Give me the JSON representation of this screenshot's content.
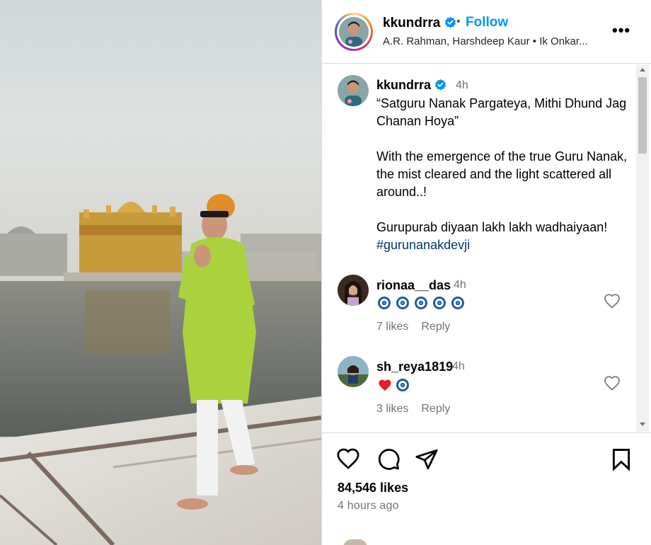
{
  "post": {
    "username": "kkundrra",
    "follow_label": "Follow",
    "separator": "•",
    "audio": "A.R. Rahman, Harshdeep Kaur • Ik Onkar...",
    "more_label": "•••"
  },
  "caption": {
    "username": "kkundrra",
    "time": "4h",
    "text_lines": "“Satguru Nanak Pargateya, Mithi Dhund Jag Chanan Hoya”\n\nWith the emergence of the true Guru Nanak, the mist cleared and the light scattered all around..!\n\nGurupurab diyaan lakh lakh wadhaiyaan! ",
    "hashtag": "#gurunanakdevji"
  },
  "comments": [
    {
      "username": "rionaa__das",
      "time": "4h",
      "emoji": [
        "evil-eye",
        "evil-eye",
        "evil-eye",
        "evil-eye",
        "evil-eye"
      ],
      "likes": "7 likes",
      "reply": "Reply"
    },
    {
      "username": "sh_reya1819",
      "time": "4h",
      "emoji": [
        "red-heart",
        "evil-eye"
      ],
      "likes": "3 likes",
      "reply": "Reply"
    }
  ],
  "footer": {
    "likes": "84,546 likes",
    "time_ago": "4 hours ago"
  },
  "icons": {
    "like": "heart-outline-icon",
    "comment": "speech-bubble-icon",
    "share": "paper-plane-icon",
    "save": "bookmark-icon",
    "verified": "verified-badge-icon"
  },
  "colors": {
    "follow": "#0095f6",
    "hashtag": "#00376b",
    "verified": "#0095f6",
    "muted": "#737373",
    "border": "#dbdbdb"
  }
}
